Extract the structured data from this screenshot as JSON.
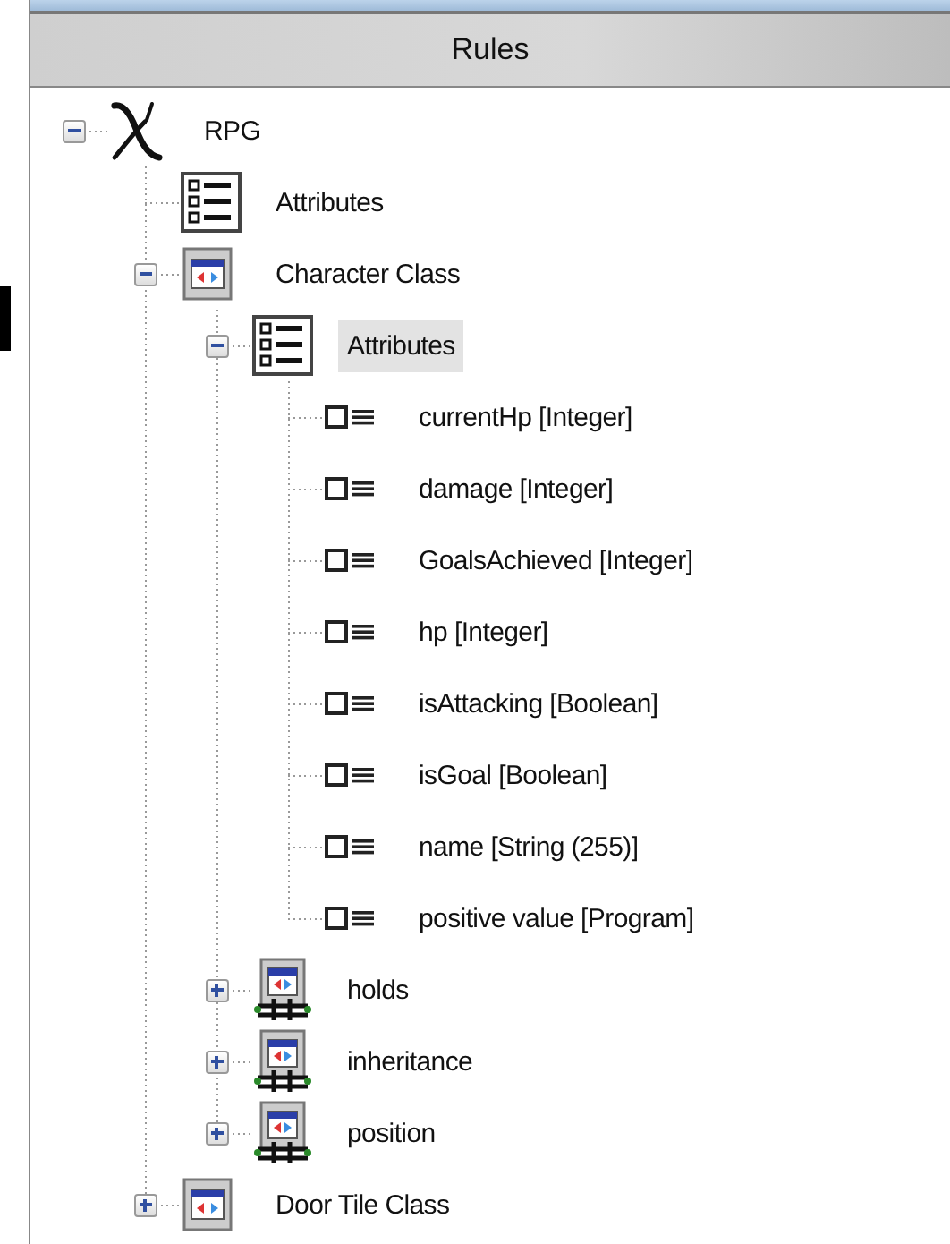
{
  "panel": {
    "title": "Rules"
  },
  "tree": [
    {
      "label": "RPG",
      "kind": "root",
      "expanded": true,
      "selected": false,
      "children": [
        {
          "label": "Attributes",
          "kind": "list",
          "selected": false
        },
        {
          "label": "Character Class",
          "kind": "class",
          "expanded": true,
          "selected": false,
          "children": [
            {
              "label": "Attributes",
              "kind": "list",
              "expanded": true,
              "selected": true,
              "children": [
                {
                  "label": "currentHp [Integer]",
                  "kind": "attribute",
                  "selected": false
                },
                {
                  "label": "damage [Integer]",
                  "kind": "attribute",
                  "selected": false
                },
                {
                  "label": "GoalsAchieved [Integer]",
                  "kind": "attribute",
                  "selected": false
                },
                {
                  "label": "hp [Integer]",
                  "kind": "attribute",
                  "selected": false
                },
                {
                  "label": "isAttacking [Boolean]",
                  "kind": "attribute",
                  "selected": false
                },
                {
                  "label": "isGoal [Boolean]",
                  "kind": "attribute",
                  "selected": false
                },
                {
                  "label": "name [String (255)]",
                  "kind": "attribute",
                  "selected": false
                },
                {
                  "label": "positive value [Program]",
                  "kind": "attribute",
                  "selected": false
                }
              ]
            },
            {
              "label": "holds",
              "kind": "relation",
              "expanded": false,
              "selected": false
            },
            {
              "label": "inheritance",
              "kind": "relation",
              "expanded": false,
              "selected": false
            },
            {
              "label": "position",
              "kind": "relation",
              "expanded": false,
              "selected": false
            }
          ]
        },
        {
          "label": "Door Tile Class",
          "kind": "class",
          "expanded": false,
          "selected": false
        }
      ]
    }
  ]
}
